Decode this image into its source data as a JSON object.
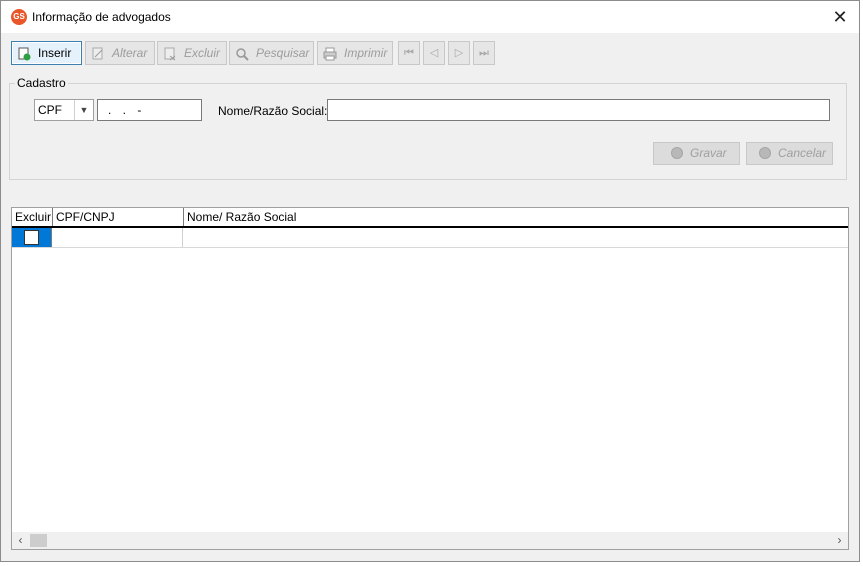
{
  "window": {
    "title": "Informação de advogados",
    "icon": "gs-app-icon",
    "close": "✕"
  },
  "toolbar": {
    "inserir": "Inserir",
    "alterar": "Alterar",
    "excluir": "Excluir",
    "pesquisar": "Pesquisar",
    "imprimir": "Imprimir",
    "nav_first": "⏮",
    "nav_prev": "◁",
    "nav_next": "▷",
    "nav_last": "⏭"
  },
  "cadastro": {
    "title": "Cadastro",
    "doc_type": "CPF",
    "doc_value": ". . -",
    "nome_label": "Nome/Razão Social:",
    "nome_value": "",
    "gravar": "Gravar",
    "cancelar": "Cancelar"
  },
  "grid": {
    "columns": [
      "Excluir",
      "CPF/CNPJ",
      "Nome/ Razão Social"
    ],
    "rows": [
      {
        "excluir": false,
        "cpf_cnpj": "",
        "nome": ""
      }
    ]
  },
  "colors": {
    "selection": "#0078d7",
    "active_button_border": "#3c7fb1",
    "app_icon": "#e8562a"
  },
  "icons": [
    "insert-icon",
    "edit-icon",
    "delete-icon",
    "search-icon",
    "print-icon",
    "check-circle-icon",
    "cancel-circle-icon"
  ]
}
